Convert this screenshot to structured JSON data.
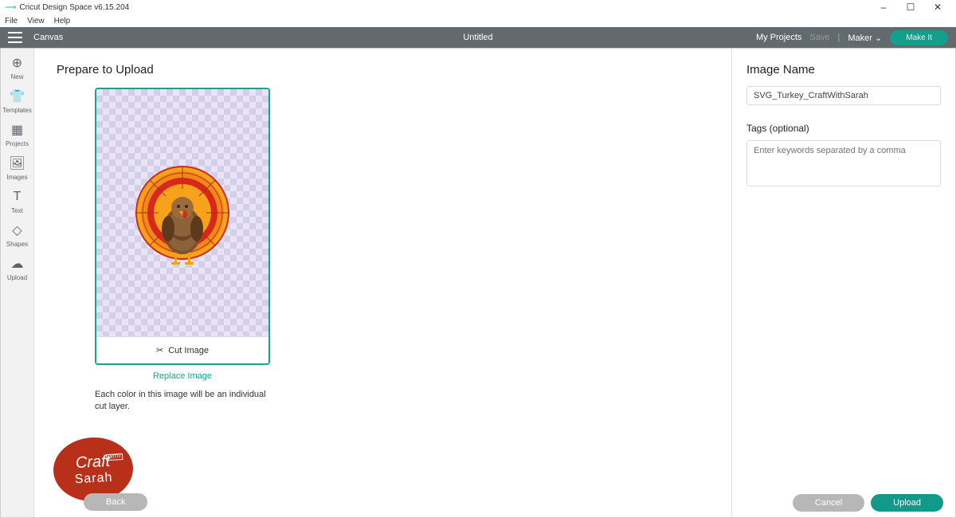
{
  "window": {
    "app_title": "Cricut Design Space  v6.15.204",
    "controls": {
      "min": "–",
      "max": "☐",
      "close": "✕"
    }
  },
  "menubar": [
    "File",
    "View",
    "Help"
  ],
  "toolbar": {
    "canvas": "Canvas",
    "doc_title": "Untitled",
    "my_projects": "My Projects",
    "save": "Save",
    "machine": "Maker",
    "make_it": "Make It"
  },
  "sidebar": {
    "items": [
      {
        "icon": "⊕",
        "label": "New"
      },
      {
        "icon": "👕",
        "label": "Templates"
      },
      {
        "icon": "▦",
        "label": "Projects"
      },
      {
        "icon": "🖼",
        "label": "Images"
      },
      {
        "icon": "T",
        "label": "Text"
      },
      {
        "icon": "◇",
        "label": "Shapes"
      },
      {
        "icon": "☁",
        "label": "Upload"
      }
    ]
  },
  "main": {
    "title": "Prepare to Upload",
    "cut_label": "Cut Image",
    "replace_link": "Replace Image",
    "helper": "Each color in this image will be an individual cut layer."
  },
  "form": {
    "name_heading": "Image Name",
    "name_value": "SVG_Turkey_CraftWithSarah",
    "tags_label": "Tags (optional)",
    "tags_placeholder": "Enter keywords separated by a comma"
  },
  "footer": {
    "back": "Back",
    "cancel": "Cancel",
    "upload": "Upload"
  },
  "badge": {
    "line1": "Craft",
    "with": "WITH",
    "line2": "Sarah"
  }
}
